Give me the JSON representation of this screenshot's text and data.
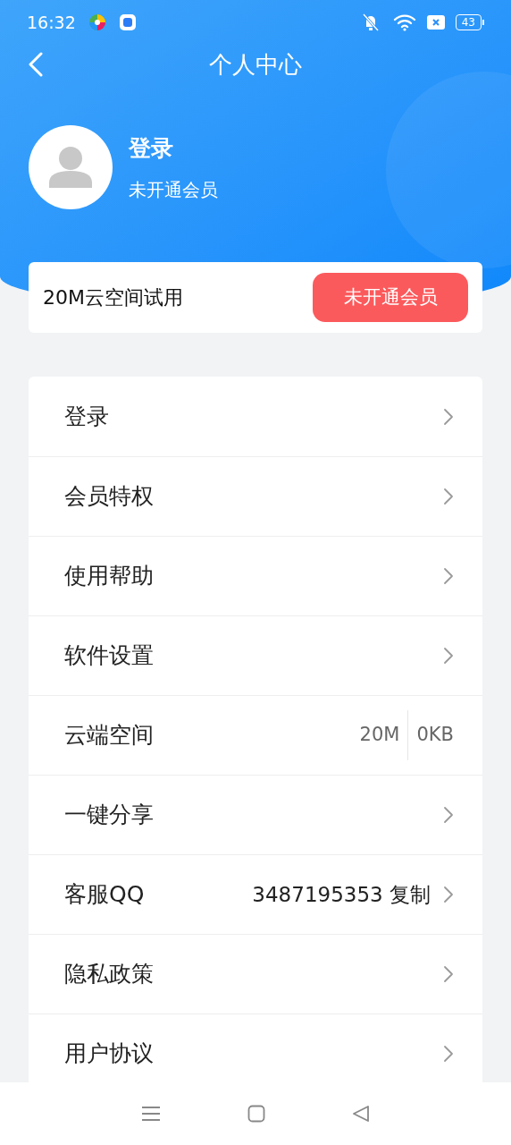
{
  "status_bar": {
    "time": "16:32",
    "battery": "43"
  },
  "header": {
    "title": "个人中心"
  },
  "profile": {
    "name": "登录",
    "membership": "未开通会员"
  },
  "trial_card": {
    "text": "20M云空间试用",
    "button": "未开通会员"
  },
  "menu": [
    {
      "kind": "link",
      "label": "登录"
    },
    {
      "kind": "link",
      "label": "会员特权"
    },
    {
      "kind": "link",
      "label": "使用帮助"
    },
    {
      "kind": "link",
      "label": "软件设置"
    },
    {
      "kind": "storage",
      "label": "云端空间",
      "total": "20M",
      "used": "0KB"
    },
    {
      "kind": "link",
      "label": "一键分享"
    },
    {
      "kind": "contact",
      "label": "客服QQ",
      "value": "3487195353 复制"
    },
    {
      "kind": "link",
      "label": "隐私政策"
    },
    {
      "kind": "link",
      "label": "用户协议"
    }
  ]
}
